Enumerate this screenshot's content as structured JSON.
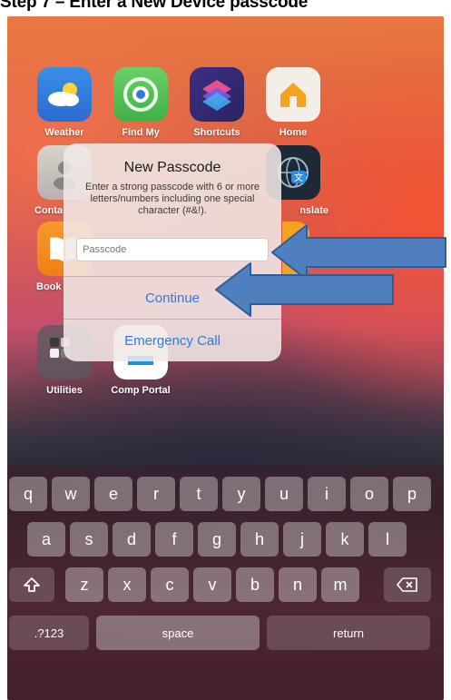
{
  "caption": "Step 7 – Enter a New Device passcode",
  "apps": [
    {
      "label": "Weather",
      "icon": "weather-icon"
    },
    {
      "label": "Find My",
      "icon": "find-my-icon"
    },
    {
      "label": "Shortcuts",
      "icon": "shortcuts-icon"
    },
    {
      "label": "Home",
      "icon": "home-icon"
    },
    {
      "label": "Conta",
      "icon": "contacts-icon"
    },
    {
      "label": "nslate",
      "icon": "translate-icon"
    },
    {
      "label": "Book",
      "icon": "books-icon"
    },
    {
      "label": "Utilities",
      "icon": "utilities-folder-icon"
    },
    {
      "label": "Comp Portal",
      "icon": "comp-portal-icon"
    }
  ],
  "dialog": {
    "title": "New Passcode",
    "message": "Enter a strong passcode with 6 or more letters/numbers including one special character (#&!).",
    "input_placeholder": "Passcode",
    "input_value": "",
    "continue_label": "Continue",
    "emergency_label": "Emergency Call"
  },
  "keyboard": {
    "row1": [
      "q",
      "w",
      "e",
      "r",
      "t",
      "y",
      "u",
      "i",
      "o",
      "p"
    ],
    "row2": [
      "a",
      "s",
      "d",
      "f",
      "g",
      "h",
      "j",
      "k",
      "l"
    ],
    "row3": [
      "z",
      "x",
      "c",
      "v",
      "b",
      "n",
      "m"
    ],
    "shift_icon": "shift-icon",
    "delete_icon": "delete-icon",
    "numbers_label": ".?123",
    "space_label": "space",
    "return_label": "return"
  },
  "colors": {
    "accent": "#2a7de6",
    "callout_fill": "#4f7fbf",
    "callout_stroke": "#2e5c9a"
  }
}
